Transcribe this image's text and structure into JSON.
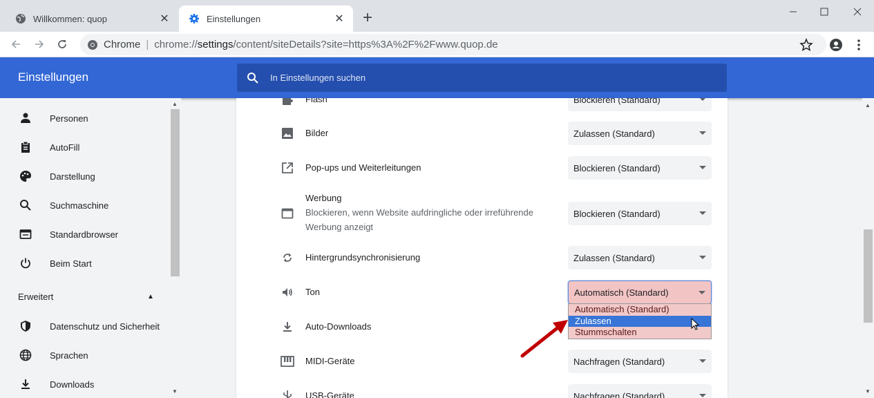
{
  "tabs": [
    {
      "label": "Willkommen: quop",
      "icon": "globe-icon"
    },
    {
      "label": "Einstellungen",
      "icon": "gear-icon"
    }
  ],
  "omnibox": {
    "prefix": "Chrome",
    "sep": "|",
    "url_scheme": "chrome://",
    "url_host": "settings",
    "url_path": "/content/siteDetails?site=https%3A%2F%2Fwww.quop.de"
  },
  "header": {
    "title": "Einstellungen",
    "search_placeholder": "In Einstellungen suchen"
  },
  "sidebar": {
    "items": [
      {
        "label": "Personen",
        "icon": "person-icon"
      },
      {
        "label": "AutoFill",
        "icon": "clipboard-icon"
      },
      {
        "label": "Darstellung",
        "icon": "palette-icon"
      },
      {
        "label": "Suchmaschine",
        "icon": "search-icon"
      },
      {
        "label": "Standardbrowser",
        "icon": "browser-window-icon"
      },
      {
        "label": "Beim Start",
        "icon": "power-icon"
      }
    ],
    "advanced_label": "Erweitert",
    "advanced_items": [
      {
        "label": "Datenschutz und Sicherheit",
        "icon": "shield-icon"
      },
      {
        "label": "Sprachen",
        "icon": "globe-icon"
      },
      {
        "label": "Downloads",
        "icon": "download-icon"
      }
    ]
  },
  "permissions": [
    {
      "label": "Flash",
      "value": "Blockieren (Standard)",
      "icon": "puzzle-icon"
    },
    {
      "label": "Bilder",
      "value": "Zulassen (Standard)",
      "icon": "image-icon"
    },
    {
      "label": "Pop-ups und Weiterleitungen",
      "value": "Blockieren (Standard)",
      "icon": "open-in-new-icon"
    },
    {
      "label": "Werbung",
      "sublabel": "Blockieren, wenn Website aufdringliche oder irreführende",
      "sublabel2": "Werbung anzeigt",
      "value": "Blockieren (Standard)",
      "icon": "ad-window-icon"
    },
    {
      "label": "Hintergrundsynchronisierung",
      "value": "Zulassen (Standard)",
      "icon": "sync-icon"
    },
    {
      "label": "Ton",
      "value": "Automatisch (Standard)",
      "icon": "volume-icon"
    },
    {
      "label": "Auto-Downloads",
      "value": "",
      "icon": "download-icon"
    },
    {
      "label": "MIDI-Geräte",
      "value": "Nachfragen (Standard)",
      "icon": "piano-icon"
    },
    {
      "label": "USB-Geräte",
      "value": "Nachfragen (Standard)",
      "icon": "usb-icon"
    }
  ],
  "ton_dropdown": {
    "options": [
      "Automatisch (Standard)",
      "Zulassen",
      "Stummschalten"
    ],
    "highlighted": 1
  },
  "colors": {
    "header_blue": "#3367d6",
    "search_bg": "#254fae",
    "dropdown_bg": "#f2c9c9",
    "highlight": "#3875d7",
    "annotation_arrow": "#c00000"
  }
}
